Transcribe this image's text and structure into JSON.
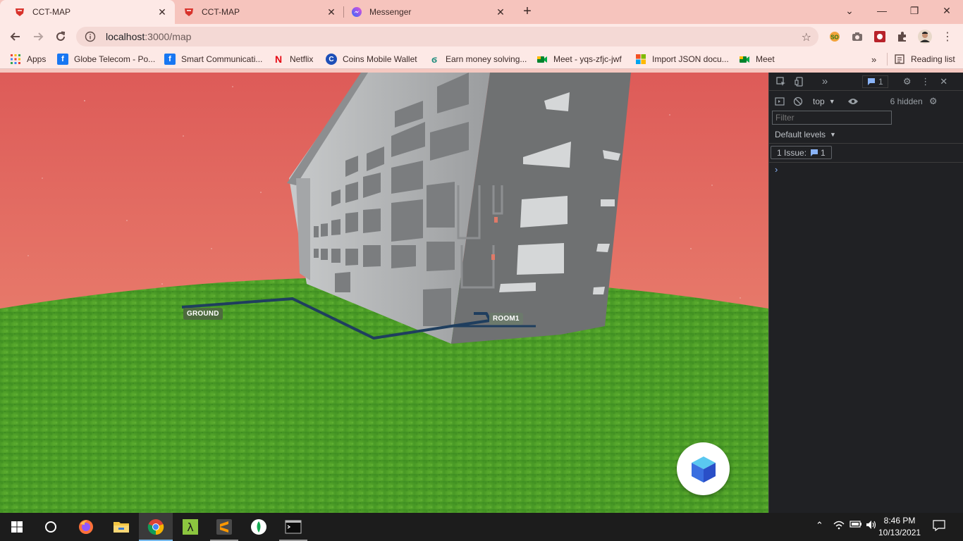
{
  "tabs": [
    {
      "title": "CCT-MAP",
      "icon": "cct-map-favicon",
      "active": true
    },
    {
      "title": "CCT-MAP",
      "icon": "cct-map-favicon",
      "active": false
    },
    {
      "title": "Messenger",
      "icon": "messenger-icon",
      "active": false
    }
  ],
  "address": {
    "host": "localhost",
    "path": ":3000/map"
  },
  "bookmarks": [
    {
      "label": "Apps",
      "icon": "apps-grid-icon"
    },
    {
      "label": "Globe Telecom - Po...",
      "icon": "facebook-icon"
    },
    {
      "label": "Smart Communicati...",
      "icon": "facebook-icon"
    },
    {
      "label": "Netflix",
      "icon": "netflix-icon"
    },
    {
      "label": "Coins Mobile Wallet",
      "icon": "coins-icon"
    },
    {
      "label": "Earn money solving...",
      "icon": "earn-icon"
    },
    {
      "label": "Meet - yqs-zfjc-jwf",
      "icon": "meet-icon"
    },
    {
      "label": "Import JSON docu...",
      "icon": "microsoft-icon"
    },
    {
      "label": "Meet",
      "icon": "meet-icon"
    }
  ],
  "reading_list": "Reading list",
  "map": {
    "labels": {
      "start": "GROUND",
      "end": "ROOM1"
    }
  },
  "devtools": {
    "context": "top",
    "hidden_count": "6 hidden",
    "filter_placeholder": "Filter",
    "levels": "Default levels",
    "issues_label": "1 Issue:",
    "issues_count": "1",
    "message_badge": "1"
  },
  "clock": {
    "time": "8:46 PM",
    "date": "10/13/2021"
  },
  "colors": {
    "sky_top": "#de5a59",
    "sky_bottom": "#ec8a6c",
    "grass": "#4f9e2a",
    "path": "#1f3e5e",
    "building_light": "#b2b4b6",
    "building_dark": "#6f7172"
  }
}
